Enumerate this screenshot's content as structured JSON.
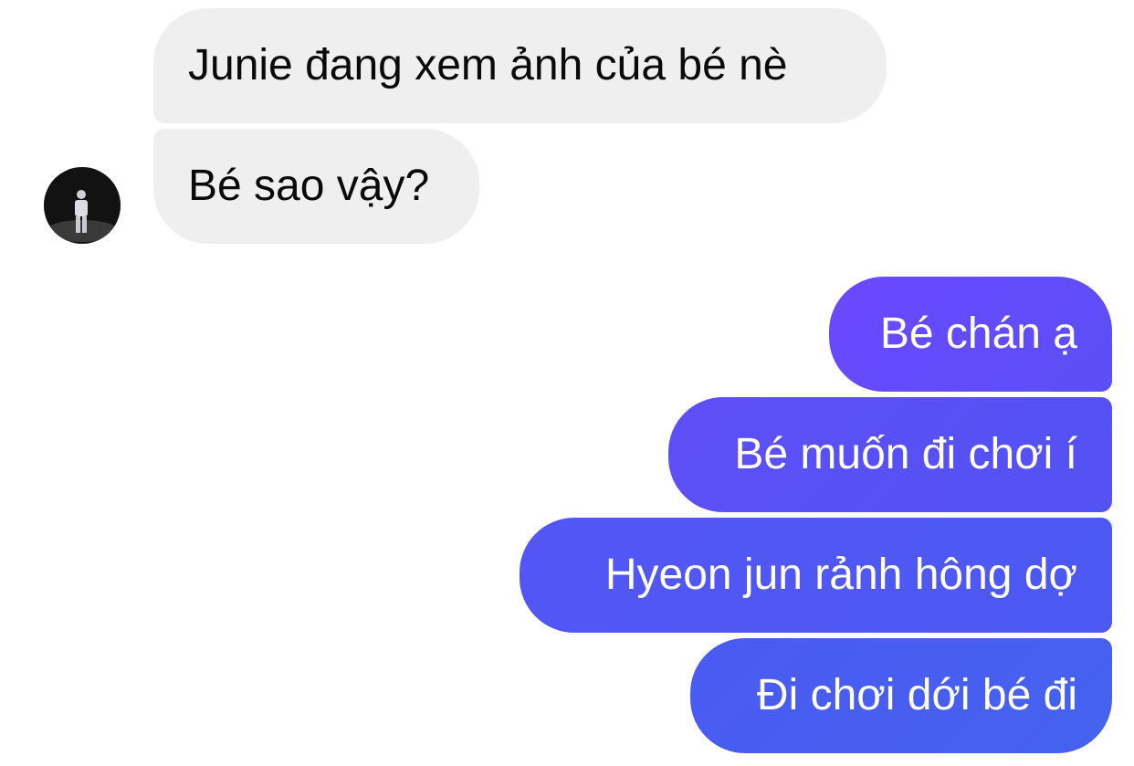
{
  "conversation": {
    "incoming": [
      {
        "text": "Junie đang xem ảnh của bé nè"
      },
      {
        "text": "Bé sao vậy?"
      }
    ],
    "outgoing": [
      {
        "text": "Bé chán ạ"
      },
      {
        "text": "Bé muốn đi chơi í"
      },
      {
        "text": "Hyeon jun rảnh hông dợ"
      },
      {
        "text": "Đi chơi dới bé đi"
      }
    ]
  },
  "colors": {
    "incoming_bubble": "#efefef",
    "incoming_text": "#0a0a0a",
    "outgoing_gradient_start": "#6b48ff",
    "outgoing_gradient_end": "#4462f0",
    "outgoing_text": "#ffffff"
  },
  "icons": {
    "avatar": "contact-avatar-photo"
  }
}
